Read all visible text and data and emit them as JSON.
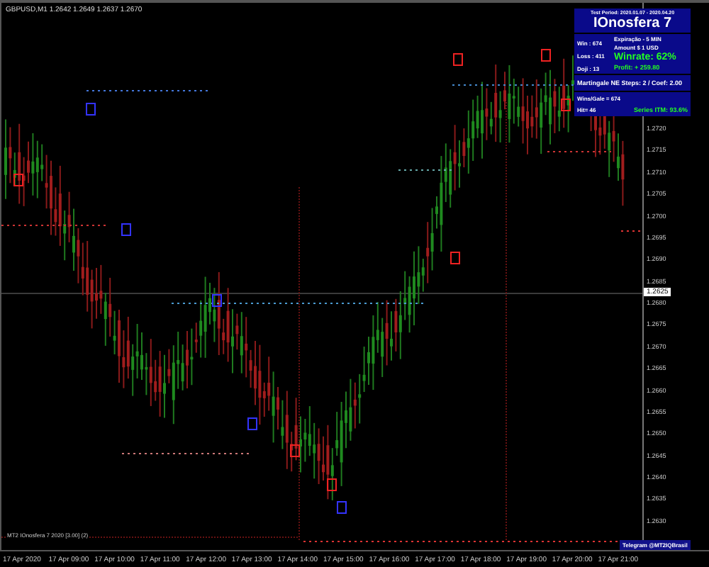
{
  "chart_header": "GBPUSD,M1 1.2642 1.2649 1.2637 1.2670",
  "indicator_label": "MT2 IOnosfera 7 2020 [3.00] (2)",
  "panel": {
    "test_period": "Test Period: 2020.01.07 - 2020.04.20",
    "title": "IOnosfera 7",
    "stats": [
      "Win : 674",
      "Loss : 411",
      "Doji : 13"
    ],
    "expiry": "Expiração - 5 MIN",
    "amount": "Amount  $ 1 USD",
    "winrate": "Winrate: 62%",
    "profit": "Profit: + 259.80",
    "martingale": "Martingale NE  Steps: 2 / Coef: 2.00",
    "wins_gale": "Wins/Gale = 674",
    "hit": "Hit= 46",
    "series": "Series ITM: 93.6%"
  },
  "telegram": "Telegram @MT2IQBrasil",
  "current_price": "1.2625",
  "price_axis": [
    "1.2720",
    "1.2715",
    "1.2710",
    "1.2705",
    "1.2700",
    "1.2695",
    "1.2690",
    "1.2685",
    "1.2680",
    "1.2675",
    "1.2670",
    "1.2665",
    "1.2660",
    "1.2655",
    "1.2650",
    "1.2645",
    "1.2640",
    "1.2635",
    "1.2630"
  ],
  "time_axis": [
    "17 Apr 2020",
    "17 Apr 09:00",
    "17 Apr 10:00",
    "17 Apr 11:00",
    "17 Apr 12:00",
    "17 Apr 13:00",
    "17 Apr 14:00",
    "17 Apr 15:00",
    "17 Apr 16:00",
    "17 Apr 17:00",
    "17 Apr 18:00",
    "17 Apr 19:00",
    "17 Apr 20:00",
    "17 Apr 21:00"
  ]
}
